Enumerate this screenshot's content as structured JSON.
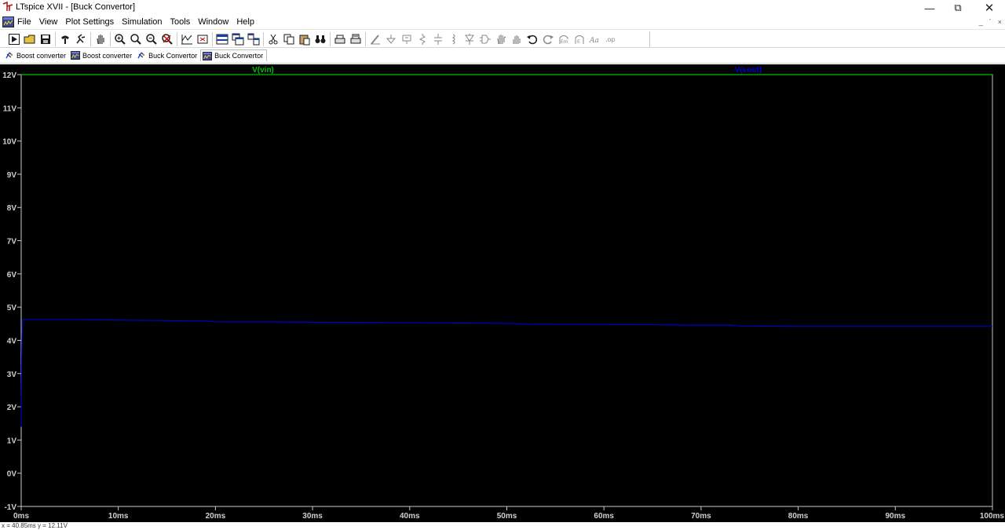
{
  "window": {
    "title": "LTspice XVII - [Buck Convertor]",
    "minimize_glyph": "—",
    "restore_glyph": "⧉",
    "close_glyph": "✕"
  },
  "menu": {
    "items": [
      "File",
      "View",
      "Plot Settings",
      "Simulation",
      "Tools",
      "Window",
      "Help"
    ],
    "mdi_buttons": [
      "_",
      "´",
      "×"
    ]
  },
  "toolbar": {
    "icons": [
      "run-icon",
      "open-icon",
      "save-icon",
      "control-panel-icon",
      "halt-icon",
      "pan-icon",
      "zoom-in-icon",
      "zoom-area-icon",
      "zoom-out-icon",
      "zoom-cancel-icon",
      "autorange-icon",
      "zoom-fit-icon",
      "tile-horizontal-icon",
      "cascade-icon",
      "tile-vertical-icon",
      "cut-icon",
      "copy-icon",
      "paste-icon",
      "find-icon",
      "print-icon",
      "print-setup-icon",
      "wire-icon",
      "ground-icon",
      "label-icon",
      "resistor-icon",
      "capacitor-icon",
      "inductor-icon",
      "diode-icon",
      "component-icon",
      "move-icon",
      "drag-icon",
      "undo-icon",
      "redo-icon",
      "rotate-icon",
      "mirror-icon",
      "text-icon",
      "spice-directive-icon"
    ]
  },
  "tabs": [
    {
      "label": "Boost converter",
      "kind": "schematic"
    },
    {
      "label": "Boost converter",
      "kind": "waveform"
    },
    {
      "label": "Buck Convertor",
      "kind": "schematic"
    },
    {
      "label": "Buck Convertor",
      "kind": "waveform",
      "active": true
    }
  ],
  "status": {
    "cursor_readout": "x = 40.85ms   y = 12.11V"
  },
  "colors": {
    "plot_bg": "#000000",
    "axis": "#c8c8c8",
    "vin": "#00c000",
    "vout": "#0000d0"
  },
  "chart_data": {
    "type": "line",
    "xlabel": "",
    "ylabel": "",
    "xlim": [
      0,
      100
    ],
    "ylim": [
      -1,
      12
    ],
    "x_unit": "ms",
    "y_unit": "V",
    "x_ticks": [
      "0ms",
      "10ms",
      "20ms",
      "30ms",
      "40ms",
      "50ms",
      "60ms",
      "70ms",
      "80ms",
      "90ms",
      "100ms"
    ],
    "y_ticks": [
      "-1V",
      "0V",
      "1V",
      "2V",
      "3V",
      "4V",
      "5V",
      "6V",
      "7V",
      "8V",
      "9V",
      "10V",
      "11V",
      "12V"
    ],
    "grid": false,
    "series": [
      {
        "name": "V(vin)",
        "color": "#00c000",
        "x": [
          0,
          100
        ],
        "y": [
          12,
          12
        ]
      },
      {
        "name": "V(vout)",
        "color": "#0000d0",
        "x": [
          0,
          0.02,
          0.05,
          0.08,
          0.12,
          0.2,
          0.5,
          1,
          5,
          10,
          19,
          20,
          35,
          50,
          52,
          60,
          70,
          73,
          74,
          80,
          90,
          100
        ],
        "y": [
          1.4,
          2.5,
          3.5,
          4.2,
          4.55,
          4.62,
          4.63,
          4.63,
          4.63,
          4.61,
          4.58,
          4.56,
          4.54,
          4.51,
          4.49,
          4.48,
          4.46,
          4.46,
          4.43,
          4.42,
          4.42,
          4.42
        ]
      }
    ]
  }
}
